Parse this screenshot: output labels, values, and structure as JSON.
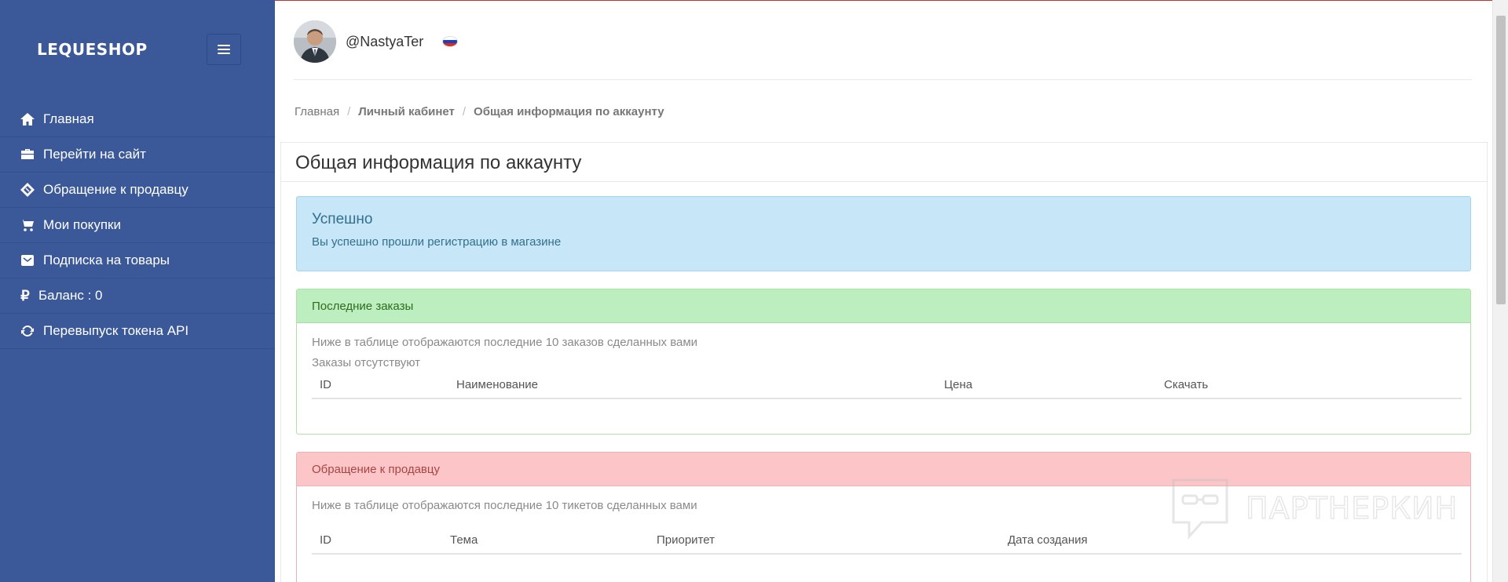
{
  "sidebar": {
    "brand": "LEQUESHOP",
    "toggle_icon": "hamburger-icon",
    "items": [
      {
        "label": "Главная",
        "icon": "home-icon"
      },
      {
        "label": "Перейти на сайт",
        "icon": "briefcase-icon"
      },
      {
        "label": "Обращение к продавцу",
        "icon": "ticket-icon"
      },
      {
        "label": "Мои покупки",
        "icon": "cart-icon"
      },
      {
        "label": "Подписка на товары",
        "icon": "envelope-icon"
      },
      {
        "label": "Баланс : 0",
        "icon": "ruble-icon",
        "glyph": "₽"
      },
      {
        "label": "Перевыпуск токена API",
        "icon": "refresh-icon"
      }
    ]
  },
  "header": {
    "username": "@NastyaTer",
    "language_flag": "flag-russia-icon"
  },
  "breadcrumb": {
    "items": [
      "Главная",
      "Личный кабинет",
      "Общая информация по аккаунту"
    ],
    "separator": "/"
  },
  "main": {
    "title": "Общая информация по аккаунту",
    "alert": {
      "heading": "Успешно",
      "text": "Вы успешно прошли регистрацию в магазине"
    },
    "orders": {
      "heading": "Последние заказы",
      "note": "Ниже в таблице отображаются последние 10 заказов сделанных вами",
      "empty": "Заказы отсутствуют",
      "columns": [
        "ID",
        "Наименование",
        "Цена",
        "Скачать"
      ]
    },
    "tickets": {
      "heading": "Обращение к продавцу",
      "note": "Ниже в таблице отображаются последние 10 тикетов сделанных вами",
      "columns": [
        "ID",
        "Тема",
        "Приоритет",
        "Дата создания"
      ]
    }
  },
  "watermark": {
    "text": "ПАРТНЕРКИН"
  },
  "colors": {
    "sidebar_bg": "#3b5998",
    "info_bg": "#c7e6f7",
    "success_bg": "#bdeebf",
    "danger_bg": "#fcc6c8"
  }
}
